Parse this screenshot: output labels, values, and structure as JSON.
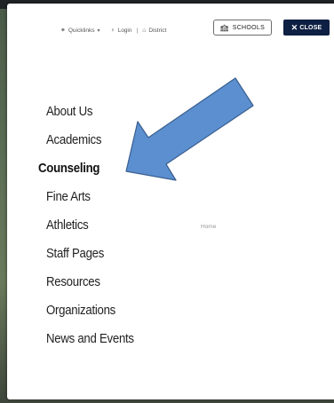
{
  "utility_bar": {
    "quicklinks": "Quicklinks",
    "login": "Login",
    "separator": "|",
    "district": "District",
    "schools": "SCHOOLS",
    "close": "CLOSE"
  },
  "nav": {
    "items": [
      {
        "label": "About Us",
        "active": false
      },
      {
        "label": "Academics",
        "active": false
      },
      {
        "label": "Counseling",
        "active": true
      },
      {
        "label": "Fine Arts",
        "active": false
      },
      {
        "label": "Athletics",
        "active": false
      },
      {
        "label": "Staff Pages",
        "active": false
      },
      {
        "label": "Resources",
        "active": false
      },
      {
        "label": "Organizations",
        "active": false
      },
      {
        "label": "News and Events",
        "active": false
      }
    ]
  },
  "home_link": "Home",
  "annotation": {
    "arrow_color": "#5b8fd0",
    "arrow_stroke": "#3a5f8f"
  }
}
